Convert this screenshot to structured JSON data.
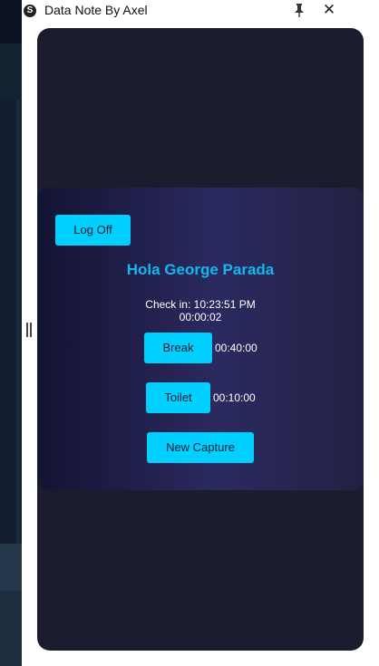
{
  "window": {
    "title": "Data Note By Axel",
    "icon": "app-logo-icon",
    "controls": [
      "pin-icon",
      "close-icon"
    ],
    "close_glyph": "✕",
    "logo_glyph": "S"
  },
  "session": {
    "logoff_label": "Log Off",
    "greeting": "Hola George Parada",
    "checkin_label": "Check in:",
    "checkin_time": "10:23:51 PM",
    "elapsed": "00:00:02"
  },
  "actions": {
    "break_label": "Break",
    "break_time": "00:40:00",
    "toilet_label": "Toilet",
    "toilet_time": "00:10:00",
    "capture_label": "New Capture"
  },
  "colors": {
    "accent": "#00cfff",
    "greeting": "#14b8f0",
    "panel": "#1b1d2e"
  }
}
